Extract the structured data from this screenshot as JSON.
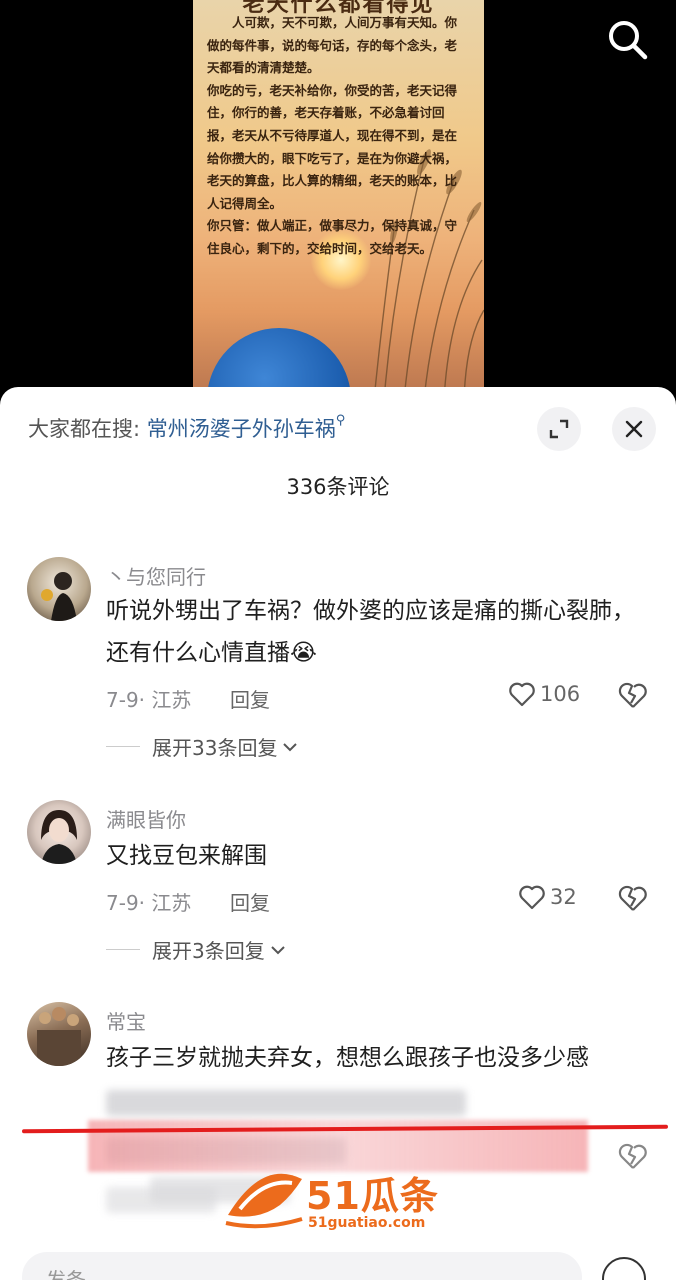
{
  "video": {
    "poster_title": "老天什么都看得见",
    "poster_body": "人可欺，天不可欺，人间万事有天知。你做的每件事，说的每句话，存的每个念头，老天都看的清清楚楚。\n你吃的亏，老天补给你，你受的苦，老天记得住，你行的善，老天存着账，不必急着讨回报，老天从不亏待厚道人，现在得不到，是在给你攒大的，眼下吃亏了，是在为你避大祸，老天的算盘，比人算的精细，老天的账本，比人记得周全。\n你只管：做人端正，做事尽力，保持真诚，守住良心，剩下的，交给时间，交给老天。"
  },
  "header": {
    "hot_search_prefix": "大家都在搜:",
    "hot_search_term": "常州汤婆子外孙车祸",
    "comment_count": "336条评论"
  },
  "comments": [
    {
      "username": "丶与您同行",
      "text": "听说外甥出了车祸？做外婆的应该是痛的撕心裂肺，还有什么心情直播😭",
      "date_location": "7-9· 江苏",
      "reply_label": "回复",
      "likes": "106",
      "expand_label": "展开33条回复"
    },
    {
      "username": "满眼皆你",
      "text": "又找豆包来解围",
      "date_location": "7-9· 江苏",
      "reply_label": "回复",
      "likes": "32",
      "expand_label": "展开3条回复"
    },
    {
      "username": "常宝",
      "text": "孩子三岁就抛夫弃女，想想么跟孩子也没多少感"
    }
  ],
  "watermark": {
    "brand": "51瓜条",
    "url": "51guatiao.com"
  },
  "bottom": {
    "placeholder": "发条"
  },
  "colors": {
    "accent_link": "#2f5e92",
    "watermark_orange": "#ec6b1c",
    "red_line": "#e31d1d"
  }
}
